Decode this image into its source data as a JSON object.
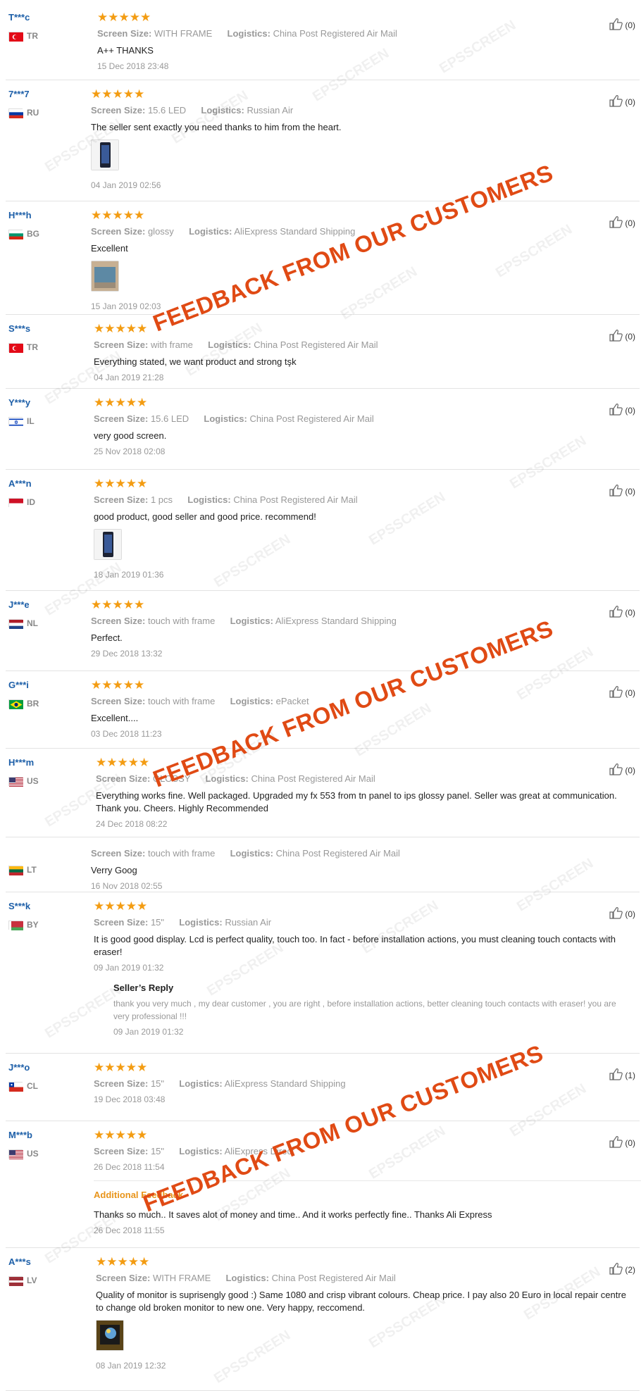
{
  "like_prefix": "(",
  "like_suffix": ")",
  "banner_text": "FEEDBACK FROM OUR CUSTOMERS",
  "watermark_text": "EPSSCREEN",
  "colors": {
    "star": "#f39c12",
    "username": "#1d5fa8",
    "banner": "#e04a14",
    "additional_feedback": "#e8941a"
  },
  "labels": {
    "screen_size": "Screen Size:",
    "logistics": "Logistics:",
    "sellers_reply": "Seller’s Reply",
    "additional_feedback": "Additional Feedback"
  },
  "reviews": [
    {
      "user": "T***c",
      "country": "TR",
      "flag": "TR",
      "stars": "★★★★★",
      "screen_size": "WITH FRAME",
      "logistics": "China Post Registered Air Mail",
      "text": "A++ THANKS",
      "date": "15 Dec 2018 23:48",
      "likes": "0",
      "photo": null,
      "reply": null,
      "additional": null
    },
    {
      "user": "7***7",
      "country": "RU",
      "flag": "RU",
      "stars": "★★★★★",
      "screen_size": "15.6 LED",
      "logistics": "Russian Air",
      "text": "The seller sent exactly you need thanks to him from the heart.",
      "date": "04 Jan 2019 02:56",
      "likes": "0",
      "photo": "phone-photo",
      "reply": null,
      "additional": null
    },
    {
      "user": "H***h",
      "country": "BG",
      "flag": "BG",
      "stars": "★★★★★",
      "screen_size": "glossy",
      "logistics": "AliExpress Standard Shipping",
      "text": "Excellent",
      "date": "15 Jan 2019 02:03",
      "likes": "0",
      "photo": "product-photo",
      "reply": null,
      "additional": null
    },
    {
      "user": "S***s",
      "country": "TR",
      "flag": "TR",
      "stars": "★★★★★",
      "screen_size": "with frame",
      "logistics": "China Post Registered Air Mail",
      "text": "Everything stated, we want product and strong tşk",
      "date": "04 Jan 2019 21:28",
      "likes": "0",
      "photo": null,
      "reply": null,
      "additional": null
    },
    {
      "user": "Y***y",
      "country": "IL",
      "flag": "IL",
      "stars": "★★★★★",
      "screen_size": "15.6 LED",
      "logistics": "China Post Registered Air Mail",
      "text": "very good screen.",
      "date": "25 Nov 2018 02:08",
      "likes": "0",
      "photo": null,
      "reply": null,
      "additional": null
    },
    {
      "user": "A***n",
      "country": "ID",
      "flag": "ID",
      "stars": "★★★★★",
      "screen_size": "1 pcs",
      "logistics": "China Post Registered Air Mail",
      "text": "good product, good seller and good price. recommend!",
      "date": "18 Jan 2019 01:36",
      "likes": "0",
      "photo": "phone-photo",
      "reply": null,
      "additional": null
    },
    {
      "user": "J***e",
      "country": "NL",
      "flag": "NL",
      "stars": "★★★★★",
      "screen_size": "touch with frame",
      "logistics": "AliExpress Standard Shipping",
      "text": "Perfect.",
      "date": "29 Dec 2018 13:32",
      "likes": "0",
      "photo": null,
      "reply": null,
      "additional": null
    },
    {
      "user": "G***i",
      "country": "BR",
      "flag": "BR",
      "stars": "★★★★★",
      "screen_size": "touch with frame",
      "logistics": "ePacket",
      "text": "Excellent....",
      "date": "03 Dec 2018 11:23",
      "likes": "0",
      "photo": null,
      "reply": null,
      "additional": null
    },
    {
      "user": "H***m",
      "country": "US",
      "flag": "US",
      "stars": "★★★★★",
      "screen_size": "GLOSSY",
      "logistics": "China Post Registered Air Mail",
      "text": "Everything works fine. Well packaged. Upgraded my fx 553 from tn panel to ips glossy panel. Seller was great at communication. Thank you. Cheers. Highly Recommended",
      "date": "24 Dec 2018 08:22",
      "likes": "0",
      "photo": null,
      "reply": null,
      "additional": null
    },
    {
      "user": "",
      "country": "LT",
      "flag": "LT",
      "stars": "",
      "screen_size": "touch with frame",
      "logistics": "China Post Registered Air Mail",
      "text": "Verry Goog",
      "date": "16 Nov 2018 02:55",
      "likes": null,
      "photo": null,
      "reply": null,
      "additional": null
    },
    {
      "user": "S***k",
      "country": "BY",
      "flag": "BY",
      "stars": "★★★★★",
      "screen_size": "15\"",
      "logistics": "Russian Air",
      "text": "It is good   good   display. Lcd is perfect quality, touch too. In fact - before installation actions, you must cleaning touch contacts with eraser!",
      "date": "09 Jan 2019 01:32",
      "likes": "0",
      "photo": null,
      "reply": {
        "text": "thank you very much , my dear customer , you are right , before installation actions, better cleaning touch contacts with eraser! you are very professional !!!",
        "date": "09 Jan 2019 01:32"
      },
      "additional": null
    },
    {
      "user": "J***o",
      "country": "CL",
      "flag": "CL",
      "stars": "★★★★★",
      "screen_size": "15\"",
      "logistics": "AliExpress Standard Shipping",
      "text": "",
      "date": "19 Dec 2018 03:48",
      "likes": "1",
      "photo": null,
      "reply": null,
      "additional": null
    },
    {
      "user": "M***b",
      "country": "US",
      "flag": "US",
      "stars": "★★★★★",
      "screen_size": "15\"",
      "logistics": "AliExpress Direct",
      "text": "",
      "date": "26 Dec 2018 11:54",
      "likes": "0",
      "photo": null,
      "reply": null,
      "additional": {
        "text": "Thanks so much.. It saves alot of money and time.. And it works perfectly fine.. Thanks Ali Express",
        "date": "26 Dec 2018 11:55"
      }
    },
    {
      "user": "A***s",
      "country": "LV",
      "flag": "LV",
      "stars": "★★★★★",
      "screen_size": "WITH FRAME",
      "logistics": "China Post Registered Air Mail",
      "text": "Quality of monitor is suprisengly good :) Same 1080 and crisp vibrant colours. Cheap price. I pay also 20 Euro in local repair centre to change old broken monitor to new one. Very happy, reccomend.",
      "date": "08 Jan 2019 12:32",
      "likes": "2",
      "photo": "screen-photo",
      "reply": null,
      "additional": null
    }
  ]
}
